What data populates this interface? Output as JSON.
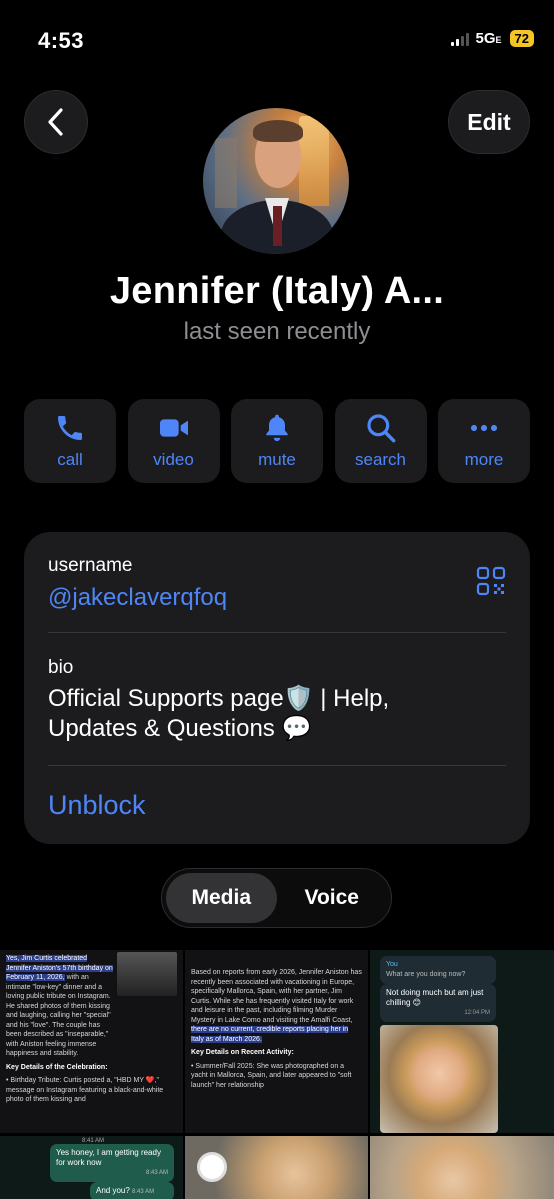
{
  "status": {
    "time": "4:53",
    "network": "5G",
    "network_suffix": "E",
    "battery": "72"
  },
  "nav": {
    "edit_label": "Edit"
  },
  "profile": {
    "name": "Jennifer (Italy) A...",
    "status": "last seen recently"
  },
  "actions": [
    {
      "icon": "phone-icon",
      "label": "call"
    },
    {
      "icon": "video-icon",
      "label": "video"
    },
    {
      "icon": "bell-icon",
      "label": "mute"
    },
    {
      "icon": "search-icon",
      "label": "search"
    },
    {
      "icon": "more-icon",
      "label": "more"
    }
  ],
  "info": {
    "username_label": "username",
    "username": "@jakeclaverqfoq",
    "bio_label": "bio",
    "bio": "Official Supports page🛡️ | Help, Updates & Questions 💬",
    "unblock_label": "Unblock"
  },
  "tabs": {
    "media": "Media",
    "voice": "Voice"
  },
  "media": {
    "c1_text_a": "Yes, Jim Curtis celebrated Jennifer Aniston's 57th birthday on February 11, 2026,",
    "c1_text_b": " with an intimate \"low-key\" dinner and a loving public tribute on Instagram. He shared photos of them kissing and laughing, calling her \"special\" and his \"love\". The couple has been described as \"inseparable,\" with Aniston feeling immense happiness and stability.",
    "c1_heading": "Key Details of the Celebration:",
    "c1_bullet": "Birthday Tribute: Curtis posted a, \"HBD MY ❤️,\" message on Instagram featuring a black-and-white photo of them kissing and",
    "c2_text_a": "Based on reports from early 2026, Jennifer Aniston has recently been associated with vacationing in Europe, specifically Mallorca, Spain, with her partner, Jim Curtis. While she has frequently visited Italy for work and leisure in the past, including filming Murder Mystery in Lake Como and visiting the Amalfi Coast, ",
    "c2_text_b": "there are no current, credible reports placing her in Italy as of March 2026.",
    "c2_heading": "Key Details on Recent Activity:",
    "c2_bullet": "Summer/Fall 2025: She was photographed on a yacht in Mallorca, Spain, and later appeared to \"soft launch\" her relationship",
    "c3_sender": "You",
    "c3_msg1": "What are you doing now?",
    "c3_msg2": "Not doing much but am just chilling 😊",
    "c3_time": "12:04 PM",
    "c4_time1": "8:41 AM",
    "c4_msg1": "Yes honey, I am getting ready for work now",
    "c4_time2": "8:43 AM",
    "c4_msg2": "And you?",
    "c4_time3": "8:43 AM"
  }
}
